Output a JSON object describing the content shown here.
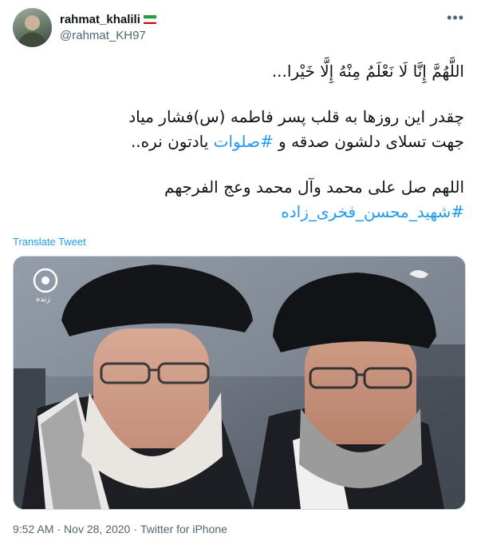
{
  "author": {
    "name": "rahmat_khalili",
    "handle": "@rahmat_KH97",
    "flag_colors": [
      "#239f40",
      "#ffffff",
      "#da0000"
    ]
  },
  "icons": {
    "more": "more-horizontal-icon"
  },
  "tweet": {
    "line1": "اللَّهُمَّ إِنَّا لَا نَعْلَمُ مِنْهُ إِلَّا خَیْرا...",
    "line2": "چقدر این روزها به قلب پسر فاطمه (س)فشار  میاد",
    "line3_before": "جهت تسلای دلشون صدقه و ",
    "line3_hashtag": "#صلوات",
    "line3_after": " یادتون نره..",
    "line4": "اللهم صل علی محمد وآل محمد وعج الفرجهم",
    "hashtag2": "#شهید_محسن_فخری_زاده"
  },
  "translate_label": "Translate Tweet",
  "media": {
    "description": "video still of two clerics in black turbans",
    "channel_logo_label": "زنده"
  },
  "footer": {
    "time": "9:52 AM",
    "date": "Nov 28, 2020",
    "source": "Twitter for iPhone"
  },
  "colors": {
    "link": "#1d9bf0",
    "secondary_text": "#536471",
    "border": "#cfd9de"
  }
}
